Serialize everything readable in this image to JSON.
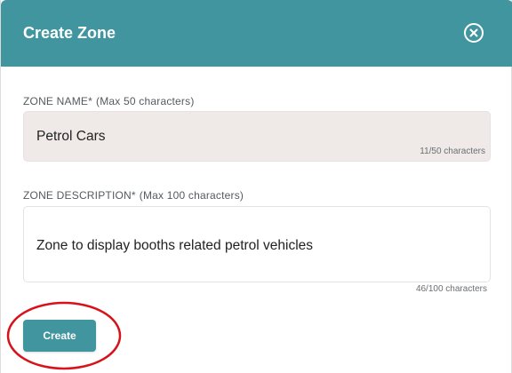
{
  "dialog": {
    "title": "Create Zone",
    "close_icon": "close-circle-icon"
  },
  "zone_name": {
    "label": "ZONE NAME*",
    "hint": "(Max 50 characters)",
    "value": "Petrol Cars",
    "counter": "11/50 characters",
    "length": 11,
    "max": 50
  },
  "zone_description": {
    "label": "ZONE DESCRIPTION*",
    "hint": "(Max 100 characters)",
    "value": "Zone to display booths related petrol vehicles",
    "counter": "46/100 characters",
    "length": 46,
    "max": 100
  },
  "actions": {
    "create_label": "Create"
  },
  "colors": {
    "header": "#41959f",
    "button": "#41959f",
    "name_field_bg": "#efe9e8",
    "annotation": "#d8121b"
  }
}
